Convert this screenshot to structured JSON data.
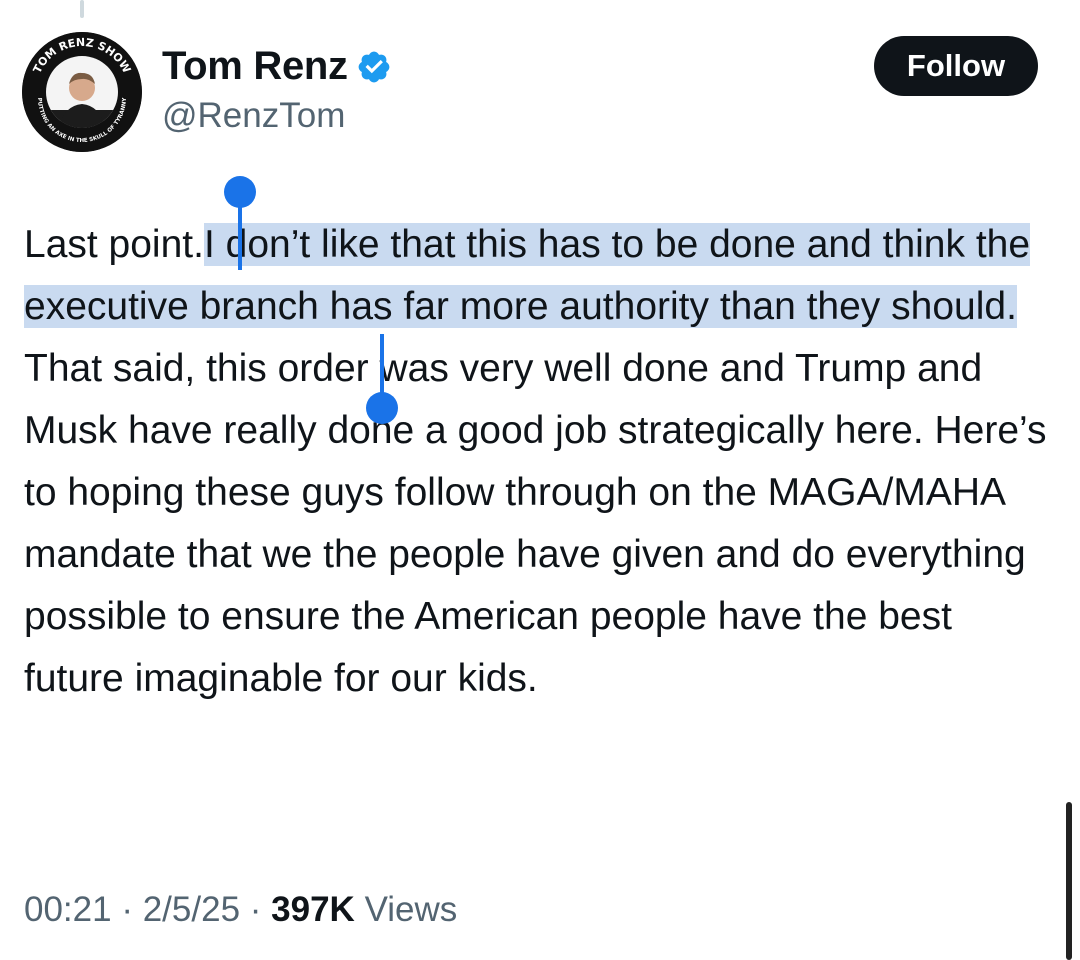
{
  "author": {
    "display_name": "Tom Renz",
    "handle": "@RenzTom",
    "verified": true,
    "avatar_ring_text_top": "TOM RENZ SHOW",
    "avatar_ring_text_bottom": "PUTTING AN AXE IN THE SKULL OF TYRANNY"
  },
  "follow_button": {
    "label": "Follow"
  },
  "tweet": {
    "text_before_selection": "Last point.",
    "text_selected": "I don’t like that this has to be done and think the executive branch has far more authority than they should.",
    "text_after_selection": " That said, this order was very well done and Trump and Musk have really done a good job strategically here. Here’s to hoping these guys follow through on the MAGA/MAHA mandate that we the people have given and do everything possible to ensure the American people have the best future imaginable for our kids."
  },
  "meta": {
    "time": "00:21",
    "separator": "·",
    "date": "2/5/25",
    "views_count": "397K",
    "views_label": "Views"
  },
  "colors": {
    "selection_highlight": "#c9daf0",
    "selection_handle": "#1a73e8",
    "verified_badge": "#1d9bf0",
    "follow_button_bg": "#0f1419",
    "secondary_text": "#536471"
  }
}
